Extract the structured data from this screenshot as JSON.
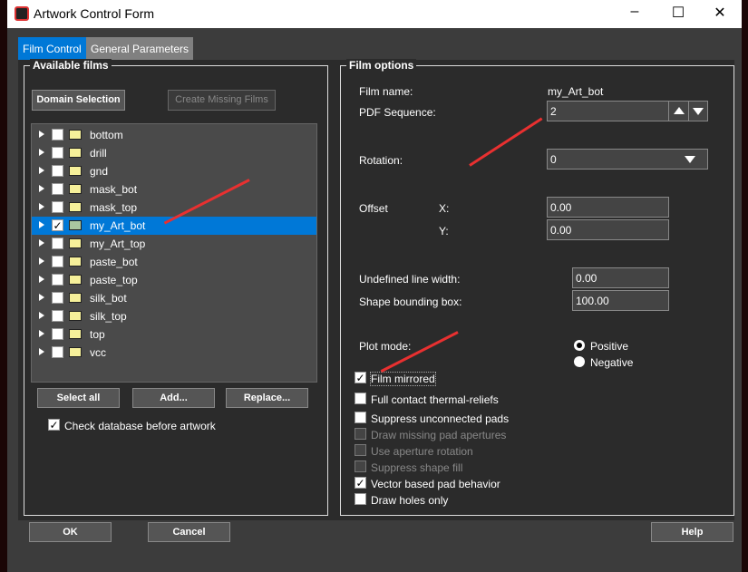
{
  "window": {
    "title": "Artwork Control Form"
  },
  "tabs": [
    {
      "label": "Film Control",
      "active": true
    },
    {
      "label": "General Parameters",
      "active": false
    }
  ],
  "available_films": {
    "title": "Available films",
    "domain_selection": "Domain Selection",
    "create_missing": "Create Missing Films",
    "films": [
      {
        "name": "bottom",
        "checked": false
      },
      {
        "name": "drill",
        "checked": false
      },
      {
        "name": "gnd",
        "checked": false
      },
      {
        "name": "mask_bot",
        "checked": false
      },
      {
        "name": "mask_top",
        "checked": false
      },
      {
        "name": "my_Art_bot",
        "checked": true,
        "selected": true
      },
      {
        "name": "my_Art_top",
        "checked": false
      },
      {
        "name": "paste_bot",
        "checked": false
      },
      {
        "name": "paste_top",
        "checked": false
      },
      {
        "name": "silk_bot",
        "checked": false
      },
      {
        "name": "silk_top",
        "checked": false
      },
      {
        "name": "top",
        "checked": false
      },
      {
        "name": "vcc",
        "checked": false
      }
    ],
    "select_all": "Select all",
    "add": "Add...",
    "replace": "Replace...",
    "check_db": "Check database before artwork",
    "check_db_checked": true
  },
  "film_options": {
    "title": "Film options",
    "film_name_label": "Film name:",
    "film_name": "my_Art_bot",
    "pdf_seq_label": "PDF Sequence:",
    "pdf_seq": "2",
    "rotation_label": "Rotation:",
    "rotation": "0",
    "offset_label": "Offset",
    "x_label": "X:",
    "x": "0.00",
    "y_label": "Y:",
    "y": "0.00",
    "undef_lw_label": "Undefined line width:",
    "undef_lw": "0.00",
    "shape_bb_label": "Shape bounding box:",
    "shape_bb": "100.00",
    "plot_mode_label": "Plot mode:",
    "positive": "Positive",
    "negative": "Negative",
    "plot_mode": "Positive",
    "options": [
      {
        "label": "Film mirrored",
        "checked": true,
        "enabled": true
      },
      {
        "label": "Full contact thermal-reliefs",
        "checked": false,
        "enabled": true
      },
      {
        "label": "Suppress unconnected pads",
        "checked": false,
        "enabled": true
      },
      {
        "label": "Draw missing pad apertures",
        "checked": false,
        "enabled": false
      },
      {
        "label": "Use aperture rotation",
        "checked": false,
        "enabled": false
      },
      {
        "label": "Suppress shape fill",
        "checked": false,
        "enabled": false
      },
      {
        "label": "Vector based pad behavior",
        "checked": true,
        "enabled": true
      },
      {
        "label": "Draw holes only",
        "checked": false,
        "enabled": true
      }
    ]
  },
  "footer": {
    "ok": "OK",
    "cancel": "Cancel",
    "help": "Help"
  }
}
